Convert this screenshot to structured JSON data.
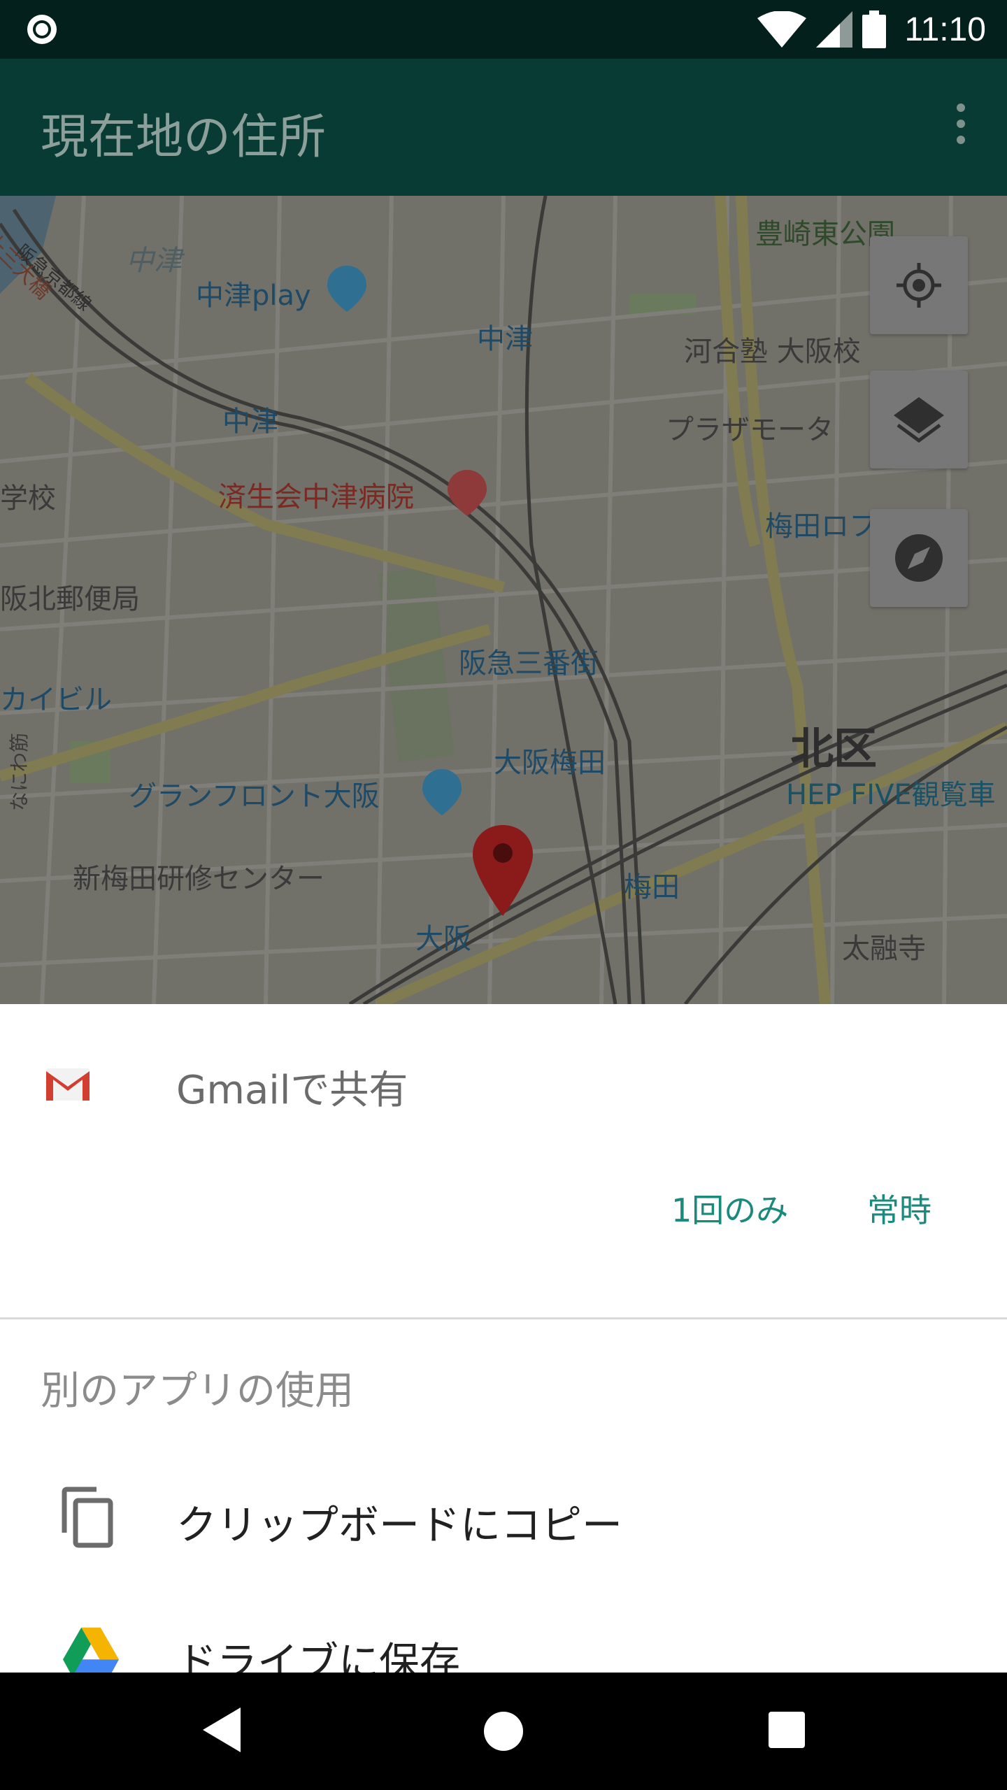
{
  "status_bar": {
    "time": "11:10"
  },
  "app_bar": {
    "title": "現在地の住所",
    "menu_icon": "more-vert-icon"
  },
  "map": {
    "labels": [
      "中津",
      "中津play",
      "中津",
      "中津",
      "河合塾 大阪校",
      "プラザモータ",
      "梅田ロフ",
      "豊崎東公園",
      "済生会中津病院",
      "学校",
      "阪北郵便局",
      "阪急三番街",
      "カイビル",
      "大阪梅田",
      "北区",
      "HEP FIVE観覧車",
      "グランフロント大阪",
      "新梅田研修センター",
      "梅田",
      "大阪",
      "太融寺",
      "阪急京都線",
      "十三大橋",
      "なにわ筋"
    ],
    "controls": [
      "my-location-icon",
      "layers-icon",
      "compass-icon"
    ]
  },
  "share_sheet": {
    "primary_app": {
      "label": "Gmailで共有",
      "icon": "gmail-icon"
    },
    "buttons": {
      "just_once": "1回のみ",
      "always": "常時"
    },
    "other_apps_title": "別のアプリの使用",
    "apps": [
      {
        "label": "クリップボードにコピー",
        "icon": "copy-icon"
      },
      {
        "label": "ドライブに保存",
        "icon": "google-drive-icon"
      }
    ]
  },
  "colors": {
    "accent": "#1a8a7d",
    "app_bar": "#083b33",
    "status_bar": "#04201c"
  }
}
